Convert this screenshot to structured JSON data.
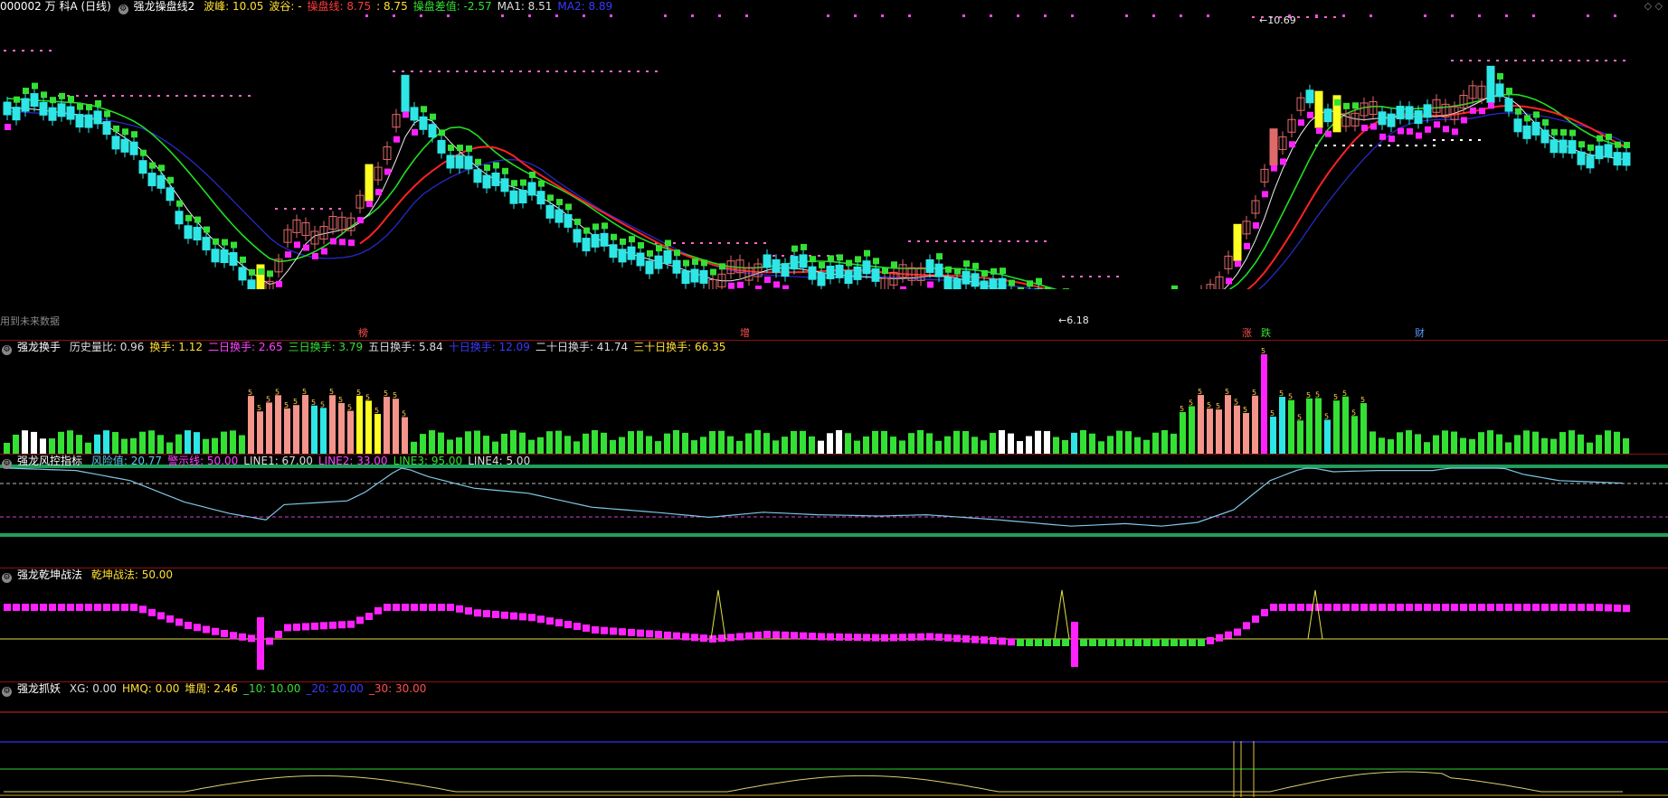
{
  "main": {
    "code_name": "000002 万 科A (日线)",
    "indicator": "强龙操盘线2",
    "fields": [
      {
        "label": "波峰:",
        "value": "10.05",
        "color": "#ffe033"
      },
      {
        "label": "波谷:",
        "value": "-",
        "color": "#ffe033"
      },
      {
        "label": "操盘线:",
        "value": "8.75",
        "color": "#ff3b3b"
      },
      {
        "label": ":",
        "value": "8.75",
        "color": "#ffe033"
      },
      {
        "label": "操盘差值:",
        "value": "-2.57",
        "color": "#34e034"
      },
      {
        "label": "MA1:",
        "value": "8.51",
        "color": "#dddddd"
      },
      {
        "label": "MA2:",
        "value": "8.89",
        "color": "#3a3aff"
      }
    ],
    "high_label": "10.69",
    "low_label": "6.18",
    "watermark": "用到未来数据",
    "markers": [
      {
        "text": "榜",
        "color": "#ff5050"
      },
      {
        "text": "增",
        "color": "#ff5050"
      },
      {
        "text": "涨",
        "color": "#ff5050"
      },
      {
        "text": "跌",
        "color": "#34e034"
      },
      {
        "text": "财",
        "color": "#5a9cff"
      }
    ],
    "corner": "◇ ◇"
  },
  "turnover": {
    "title": "强龙换手",
    "fields": [
      {
        "label": "历史量比:",
        "value": "0.96",
        "color": "#dddddd"
      },
      {
        "label": "换手:",
        "value": "1.12",
        "color": "#ffe033"
      },
      {
        "label": "二日换手:",
        "value": "2.65",
        "color": "#ff44ff"
      },
      {
        "label": "三日换手:",
        "value": "3.79",
        "color": "#34e034"
      },
      {
        "label": "五日换手:",
        "value": "5.84",
        "color": "#dddddd"
      },
      {
        "label": "十日换手:",
        "value": "12.09",
        "color": "#3a3aff"
      },
      {
        "label": "二十日换手:",
        "value": "41.74",
        "color": "#dddddd"
      },
      {
        "label": "三十日换手:",
        "value": "66.35",
        "color": "#ffe033"
      }
    ]
  },
  "risk": {
    "title": "强龙风控指标",
    "fields": [
      {
        "label": "风险值:",
        "value": "20.77",
        "color": "#5ec8e6"
      },
      {
        "label": "警示线:",
        "value": "50.00",
        "color": "#ff44ff"
      },
      {
        "label": "LINE1:",
        "value": "67.00",
        "color": "#dddddd"
      },
      {
        "label": "LINE2:",
        "value": "33.00",
        "color": "#ff44ff"
      },
      {
        "label": "LINE3:",
        "value": "95.00",
        "color": "#34e034"
      },
      {
        "label": "LINE4:",
        "value": "5.00",
        "color": "#dddddd"
      }
    ]
  },
  "qiankun": {
    "title": "强龙乾坤战法",
    "fields": [
      {
        "label": "乾坤战法:",
        "value": "50.00",
        "color": "#ffe033"
      }
    ]
  },
  "catch": {
    "title": "强龙抓妖",
    "fields": [
      {
        "label": "XG:",
        "value": "0.00",
        "color": "#dddddd"
      },
      {
        "label": "HMQ:",
        "value": "0.00",
        "color": "#ffe033"
      },
      {
        "label": "堆周:",
        "value": "2.46",
        "color": "#ffe033"
      },
      {
        "label": "_10:",
        "value": "10.00",
        "color": "#34e034"
      },
      {
        "label": "_20:",
        "value": "20.00",
        "color": "#3a3aff"
      },
      {
        "label": "_30:",
        "value": "30.00",
        "color": "#ff5050"
      }
    ]
  },
  "colors": {
    "up": "#e06a6a",
    "down": "#2ee6e6",
    "green": "#34e034",
    "magenta": "#ff22ff",
    "yellow": "#ffff22",
    "salmon": "#f4948a",
    "red_line": "#ff2222",
    "blue_line": "#2828c8"
  }
}
